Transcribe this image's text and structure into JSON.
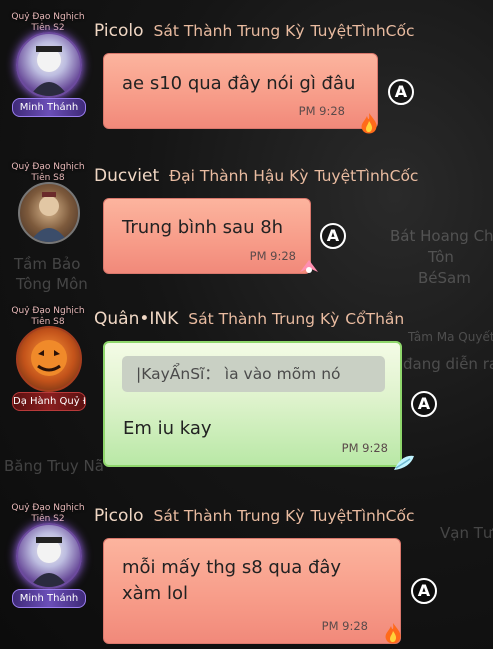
{
  "background": {
    "texts": [
      {
        "text": "Bát Hoang Ch",
        "id": "bg-text-1"
      },
      {
        "text": "Tôn",
        "id": "bg-text-2"
      },
      {
        "text": "BéSam",
        "id": "bg-text-3"
      },
      {
        "text": "Tầm Bảo",
        "id": "bg-text-4"
      },
      {
        "text": "Tông Môn",
        "id": "bg-text-5"
      },
      {
        "text": "Tâm Ma Quyết",
        "id": "bg-text-6"
      },
      {
        "text": "đang diễn ra",
        "id": "bg-text-7"
      },
      {
        "text": "Băng Truy Nã",
        "id": "bg-text-8"
      },
      {
        "text": "Vạn Tượng",
        "id": "bg-text-9"
      }
    ]
  },
  "messages": [
    {
      "avatar_title": "Quỷ Đạo Nghịch Tiên S2",
      "avatar_name": "Minh Thánh",
      "name": "Picolo",
      "rank": "Sát Thành Trung Kỳ",
      "sect": "TuyệtTìnhCốc",
      "text": "ae s10 qua đây nói gì đâu",
      "time": "PM 9:28",
      "mention_icon": "at-icon"
    },
    {
      "avatar_title": "Quỷ Đạo Nghịch Tiên S8",
      "avatar_name": "",
      "name": "Ducviet",
      "rank": "Đại Thành Hậu Kỳ",
      "sect": "TuyệtTìnhCốc",
      "text": "Trung bình sau 8h",
      "time": "PM 9:28",
      "mention_icon": "at-icon"
    },
    {
      "avatar_title": "Quỷ Đạo Nghịch Tiên S8",
      "avatar_name": "Dạ Hành Quỷ Đô",
      "name": "Quân•INK",
      "rank": "Sát Thành Trung Kỳ",
      "sect": "CổThần",
      "quote": "|KayẨnSĩ： ìa vào mõm nó",
      "text": "Em iu kay",
      "time": "PM 9:28",
      "mention_icon": "at-icon"
    },
    {
      "avatar_title": "Quỷ Đạo Nghịch Tiên S2",
      "avatar_name": "Minh Thánh",
      "name": "Picolo",
      "rank": "Sát Thành Trung Kỳ",
      "sect": "TuyệtTìnhCốc",
      "text_line1": "mỗi mấy thg s8 qua đây",
      "text_line2": "xàm lol",
      "time": "PM 9:28",
      "mention_icon": "at-icon"
    }
  ],
  "colors": {
    "red_bubble": "#f79b88",
    "green_bubble": "#dff3cd",
    "name_color": "#f0d7c4"
  }
}
